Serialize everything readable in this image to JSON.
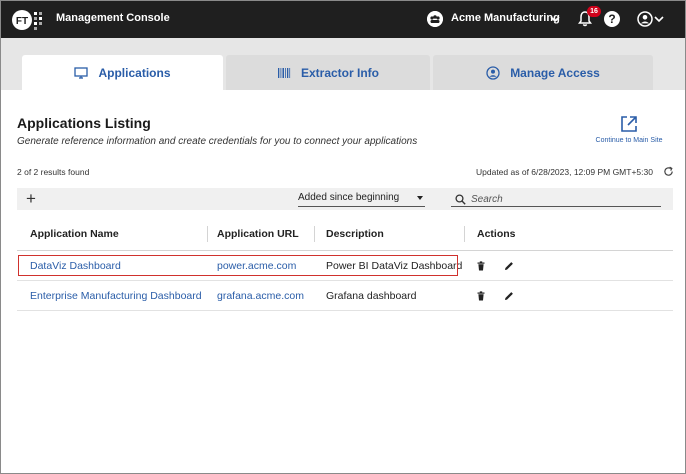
{
  "header": {
    "app_title": "Management Console",
    "tenant_name": "Acme Manufacturing",
    "notification_count": "16",
    "help_glyph": "?"
  },
  "tabs": [
    {
      "label": "Applications",
      "icon": "monitor-icon",
      "active": true
    },
    {
      "label": "Extractor Info",
      "icon": "barcode-icon",
      "active": false
    },
    {
      "label": "Manage Access",
      "icon": "user-circle-icon",
      "active": false
    }
  ],
  "page": {
    "title": "Applications Listing",
    "subtitle": "Generate reference information and create credentials for you to connect your applications",
    "main_site_label": "Continue to Main Site",
    "results_count": "2 of 2 results found",
    "updated": "Updated as of 6/28/2023, 12:09 PM GMT+5:30"
  },
  "toolbar": {
    "add_label": "+",
    "filter_value": "Added since beginning",
    "search_placeholder": "Search"
  },
  "table": {
    "columns": [
      "Application Name",
      "Application URL",
      "Description",
      "Actions"
    ],
    "rows": [
      {
        "name": "DataViz Dashboard",
        "url": "power.acme.com",
        "description": "Power BI DataViz Dashboard"
      },
      {
        "name": "Enterprise Manufacturing Dashboard",
        "url": "grafana.acme.com",
        "description": "Grafana dashboard"
      }
    ]
  },
  "colors": {
    "accent": "#2a5da8",
    "topbar": "#1f1f1f",
    "badge": "#d0021b",
    "highlight": "#d0312d"
  }
}
